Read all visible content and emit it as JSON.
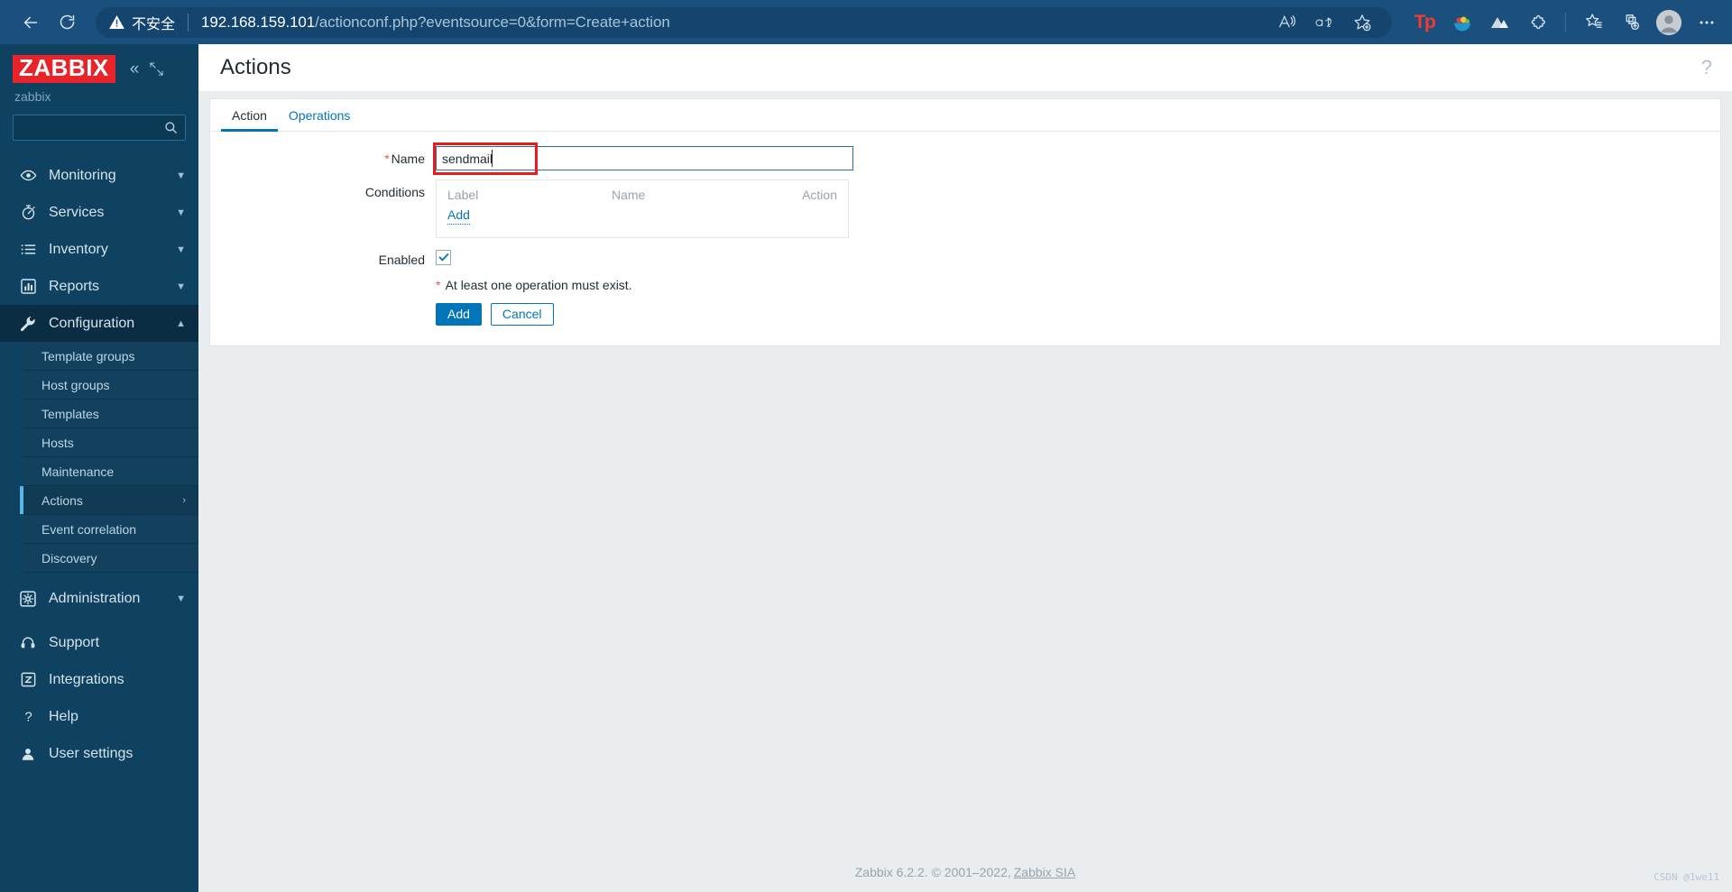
{
  "browser": {
    "back_label": "back-arrow",
    "reload_label": "reload-arrow",
    "security_label": "不安全",
    "url_host": "192.168.159.101",
    "url_path": "/actionconf.php?eventsource=0&form=Create+action",
    "omnibox_icons": [
      "read-aloud-icon",
      "translate-icon",
      "add-favorite-icon"
    ],
    "toolbar_icons": [
      "tp-extension-icon",
      "fruit-bowl-extension-icon",
      "mountain-extension-icon",
      "puzzle-extensions-icon",
      "favorites-icon",
      "collections-icon",
      "profile-avatar",
      "settings-more-icon"
    ],
    "tp_label": "Tp"
  },
  "sidebar": {
    "logo": "ZABBIX",
    "server_name": "zabbix",
    "search_placeholder": "",
    "search_value": "",
    "collapse_label": "«",
    "nav": [
      {
        "label": "Monitoring",
        "icon": "eye-icon",
        "chevron": "down",
        "active": false
      },
      {
        "label": "Services",
        "icon": "stopwatch-icon",
        "chevron": "down",
        "active": false
      },
      {
        "label": "Inventory",
        "icon": "list-icon",
        "chevron": "down",
        "active": false
      },
      {
        "label": "Reports",
        "icon": "bar-chart-icon",
        "chevron": "down",
        "active": false
      },
      {
        "label": "Configuration",
        "icon": "wrench-icon",
        "chevron": "up",
        "active": true
      }
    ],
    "subnav": [
      {
        "label": "Template groups",
        "active": false,
        "chevron": ""
      },
      {
        "label": "Host groups",
        "active": false,
        "chevron": ""
      },
      {
        "label": "Templates",
        "active": false,
        "chevron": ""
      },
      {
        "label": "Hosts",
        "active": false,
        "chevron": ""
      },
      {
        "label": "Maintenance",
        "active": false,
        "chevron": ""
      },
      {
        "label": "Actions",
        "active": true,
        "chevron": "›"
      },
      {
        "label": "Event correlation",
        "active": false,
        "chevron": ""
      },
      {
        "label": "Discovery",
        "active": false,
        "chevron": ""
      }
    ],
    "admin": {
      "label": "Administration",
      "icon": "gear-icon",
      "chevron": "down"
    },
    "bottom": [
      {
        "label": "Support",
        "icon": "headset-icon"
      },
      {
        "label": "Integrations",
        "icon": "z-square-icon"
      },
      {
        "label": "Help",
        "icon": "question-icon"
      },
      {
        "label": "User settings",
        "icon": "user-icon"
      }
    ]
  },
  "page": {
    "title": "Actions",
    "help_icon": "?"
  },
  "tabs": [
    {
      "label": "Action",
      "active": true
    },
    {
      "label": "Operations",
      "active": false
    }
  ],
  "form": {
    "name_label": "Name",
    "name_required": "*",
    "name_value": "sendmail",
    "name_placeholder": "",
    "conditions_label": "Conditions",
    "conditions_columns": [
      "Label",
      "Name",
      "Action"
    ],
    "conditions_rows": [],
    "conditions_add_label": "Add",
    "enabled_label": "Enabled",
    "enabled_checked": true,
    "error_required_mark": "*",
    "error_text": "At least one operation must exist.",
    "submit_label": "Add",
    "cancel_label": "Cancel"
  },
  "footer": {
    "text": "Zabbix 6.2.2. © 2001–2022,",
    "link": "Zabbix SIA",
    "watermark": "CSDN @1we11"
  }
}
